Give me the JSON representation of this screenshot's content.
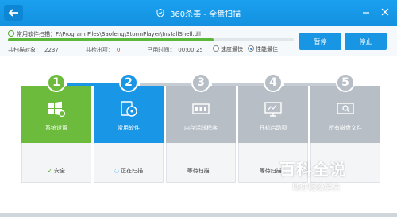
{
  "window": {
    "title": "360杀毒 - 全盘扫描"
  },
  "scan": {
    "current_path": "常用软件扫描：F:\\Program Files\\Baofeng\\StormPlayer\\InstallShell.dll",
    "progress_fraction": 0.72,
    "scanned_label": "共扫描对象：",
    "scanned_value": "2237",
    "found_label": "共检出项：",
    "found_value": "0",
    "elapsed_label": "已用时间：",
    "elapsed_value": "00:00:25",
    "speed_label": "速度最快",
    "performance_label": "性能最佳",
    "selected_mode": "performance"
  },
  "buttons": {
    "pause": "暂停",
    "stop": "停止"
  },
  "steps": [
    {
      "number": "1",
      "label": "系统设置",
      "status": "安全",
      "state": "done",
      "color": "#6cbb3c"
    },
    {
      "number": "2",
      "label": "常用软件",
      "status": "正在扫描",
      "state": "active",
      "color": "#1a96e6"
    },
    {
      "number": "3",
      "label": "内存活跃程序",
      "status": "等待扫描...",
      "state": "pending",
      "color": "#b7bec6"
    },
    {
      "number": "4",
      "label": "开机启动项",
      "status": "等待扫描...",
      "state": "pending",
      "color": "#b7bec6"
    },
    {
      "number": "5",
      "label": "所有磁盘文件",
      "status": "",
      "state": "pending",
      "color": "#b7bec6"
    }
  ],
  "watermark": {
    "title": "百科全说",
    "subtitle": "助你轻松解决"
  }
}
